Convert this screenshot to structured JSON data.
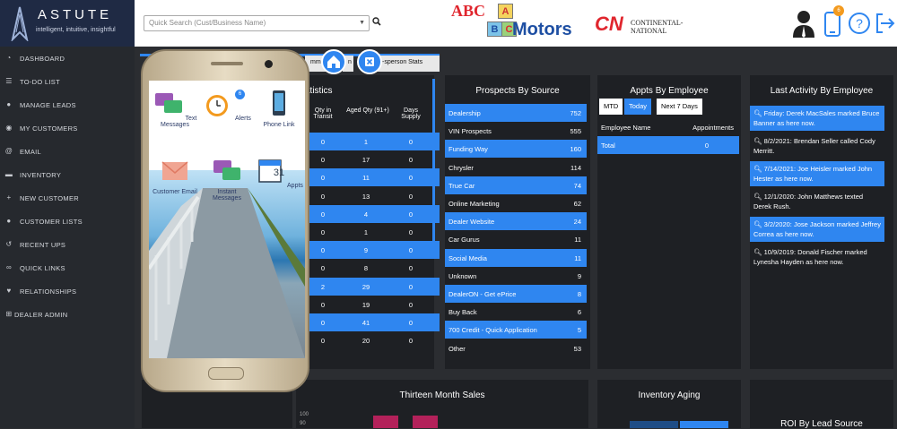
{
  "app": {
    "name": "ASTUTE",
    "tagline": "intelligent, intuitive, insightful"
  },
  "search": {
    "placeholder": "Quick Search (Cust/Business Name)"
  },
  "brands": {
    "abc_letters": "ABC",
    "abc_blocks": [
      "A",
      "B",
      "C"
    ],
    "abc_motors": "Motors",
    "cn_logo": "CN",
    "cn_name": "CONTINENTAL-NATIONAL"
  },
  "notifications": {
    "count": "6"
  },
  "sidebar": {
    "items": [
      {
        "label": "DASHBOARD",
        "icon": "gauge-icon"
      },
      {
        "label": "TO-DO LIST",
        "icon": "list-icon"
      },
      {
        "label": "MANAGE LEADS",
        "icon": "user-icon"
      },
      {
        "label": "MY CUSTOMERS",
        "icon": "users-icon"
      },
      {
        "label": "EMAIL",
        "icon": "at-icon"
      },
      {
        "label": "INVENTORY",
        "icon": "car-icon"
      },
      {
        "label": "NEW CUSTOMER",
        "icon": "plus-icon"
      },
      {
        "label": "CUSTOMER LISTS",
        "icon": "group-icon"
      },
      {
        "label": "RECENT UPS",
        "icon": "history-icon"
      },
      {
        "label": "QUICK LINKS",
        "icon": "link-icon"
      },
      {
        "label": "RELATIONSHIPS",
        "icon": "heart-icon"
      },
      {
        "label": "DEALER ADMIN",
        "icon": "plus-square-icon"
      }
    ]
  },
  "content_tabs": {
    "tab1": "mm",
    "tab1b": "n",
    "tab2": "-sperson Stats"
  },
  "inventory": {
    "title": "atistics",
    "headers": [
      "Qty in Transit",
      "Aged Qty (91+)",
      "Days Supply"
    ],
    "rows": [
      [
        "0",
        "1",
        "0"
      ],
      [
        "0",
        "17",
        "0"
      ],
      [
        "0",
        "11",
        "0"
      ],
      [
        "0",
        "13",
        "0"
      ],
      [
        "0",
        "4",
        "0"
      ],
      [
        "0",
        "1",
        "0"
      ],
      [
        "0",
        "9",
        "0"
      ],
      [
        "0",
        "8",
        "0"
      ],
      [
        "2",
        "29",
        "0"
      ],
      [
        "0",
        "19",
        "0"
      ],
      [
        "0",
        "41",
        "0"
      ],
      [
        "0",
        "20",
        "0"
      ]
    ]
  },
  "prospects": {
    "title": "Prospects By Source",
    "rows": [
      {
        "label": "Dealership",
        "value": "752"
      },
      {
        "label": "VIN Prospects",
        "value": "555"
      },
      {
        "label": "Funding Way",
        "value": "160"
      },
      {
        "label": "Chrysler",
        "value": "114"
      },
      {
        "label": "True Car",
        "value": "74"
      },
      {
        "label": "Online Marketing",
        "value": "62"
      },
      {
        "label": "Dealer Website",
        "value": "24"
      },
      {
        "label": "Car Gurus",
        "value": "11"
      },
      {
        "label": "Social Media",
        "value": "11"
      },
      {
        "label": "Unknown",
        "value": "9"
      },
      {
        "label": "DealerON - Get ePrice",
        "value": "8"
      },
      {
        "label": "Buy Back",
        "value": "6"
      },
      {
        "label": "700 Credit - Quick Application",
        "value": "5"
      },
      {
        "label": "Other",
        "value": "53"
      }
    ]
  },
  "appts": {
    "title": "Appts By Employee",
    "tabs": [
      "MTD",
      "Today",
      "Next 7 Days"
    ],
    "header": [
      "Employee Name",
      "Appointments"
    ],
    "total_label": "Total",
    "total_value": "0"
  },
  "activity": {
    "title": "Last Activity By Employee",
    "items": [
      "Friday: Derek MacSales marked Bruce Banner as here now.",
      "8/2/2021: Brendan Seller called Cody Merritt.",
      "7/14/2021: Joe Heisler marked John Hester as here now.",
      "12/1/2020: John Matthews texted Derek Rush.",
      "3/2/2020: Jose Jackson marked Jeffrey Correa as here now.",
      "10/9/2019: Donald Fischer marked Lynesha Hayden as here now."
    ]
  },
  "bottom": {
    "thirteen": "Thirteen Month Sales",
    "aging": "Inventory Aging",
    "roi": "ROI By Lead Source",
    "y100": "100",
    "y90": "90"
  },
  "phone": {
    "apps": [
      {
        "label": "Text Messages",
        "icon": "text-message-icon"
      },
      {
        "label": "Alerts",
        "icon": "alarm-clock-icon",
        "badge": "6"
      },
      {
        "label": "Phone Link",
        "icon": "smartphone-icon"
      },
      {
        "label": "Customer Email",
        "icon": "envelope-icon"
      },
      {
        "label": "Instant Messages",
        "icon": "chat-bubbles-icon"
      },
      {
        "label": "Appts",
        "icon": "calendar-icon",
        "day": "31"
      }
    ]
  }
}
